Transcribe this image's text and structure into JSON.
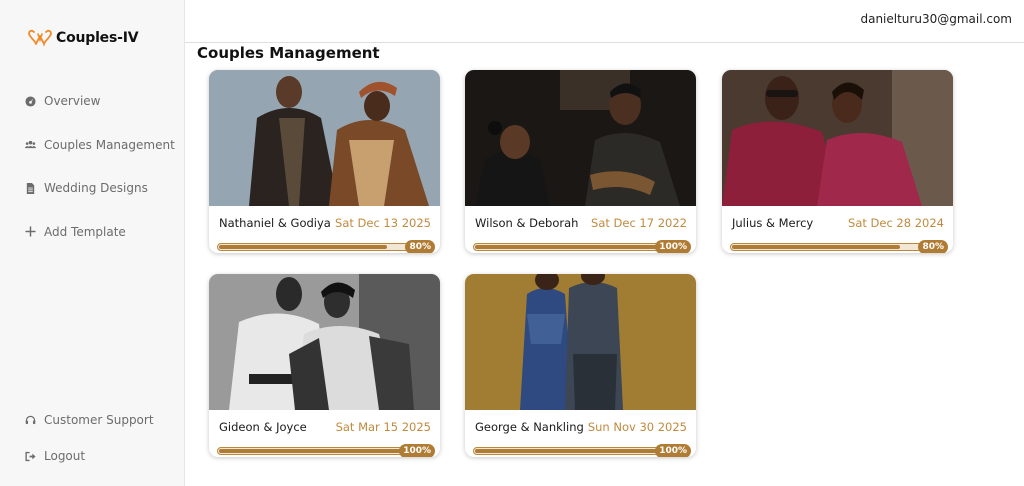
{
  "brand": {
    "name": "Couples-IV",
    "logo_icon": "hearts-logo-icon",
    "color": "#f08a2a"
  },
  "sidebar": {
    "items": [
      {
        "label": "Overview",
        "icon": "dashboard-icon"
      },
      {
        "label": "Couples Management",
        "icon": "users-icon"
      },
      {
        "label": "Wedding Designs",
        "icon": "document-icon"
      },
      {
        "label": "Add Template",
        "icon": "plus-icon"
      }
    ],
    "bottom_items": [
      {
        "label": "Customer Support",
        "icon": "headset-icon"
      },
      {
        "label": "Logout",
        "icon": "logout-icon"
      }
    ]
  },
  "header": {
    "user_email": "danielturu30@gmail.com"
  },
  "main": {
    "title": "Couples Management",
    "cards": [
      {
        "names": "Nathaniel & Godiya",
        "date": "Sat Dec 13 2025",
        "progress": 80,
        "progress_label": "80%"
      },
      {
        "names": "Wilson & Deborah",
        "date": "Sat Dec 17 2022",
        "progress": 100,
        "progress_label": "100%"
      },
      {
        "names": "Julius & Mercy",
        "date": "Sat Dec 28 2024",
        "progress": 80,
        "progress_label": "80%"
      },
      {
        "names": "Gideon & Joyce",
        "date": "Sat Mar 15 2025",
        "progress": 100,
        "progress_label": "100%"
      },
      {
        "names": "George & Nankling",
        "date": "Sun Nov 30 2025",
        "progress": 100,
        "progress_label": "100%"
      }
    ]
  },
  "colors": {
    "accent": "#c08a3e",
    "progress": "#b07c34",
    "sidebar_bg": "#f7f7f7"
  }
}
